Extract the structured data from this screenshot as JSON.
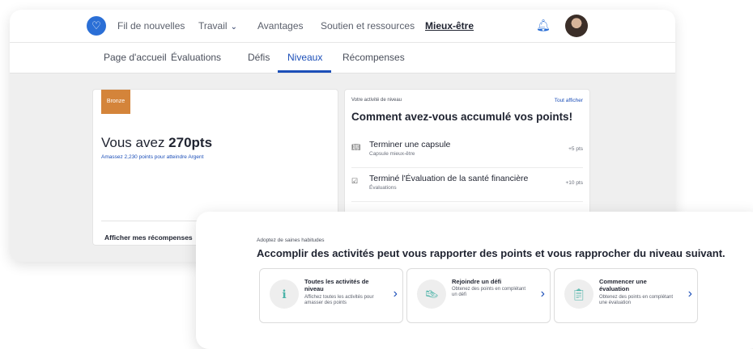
{
  "nav": {
    "items": [
      "Fil de nouvelles",
      "Travail",
      "Avantages",
      "Soutien et ressources",
      "Mieux-être"
    ]
  },
  "tabs": [
    "Page d'accueil",
    "Évaluations",
    "Défis",
    "Niveaux",
    "Récompenses"
  ],
  "level_card": {
    "badge": "Bronze",
    "points_prefix": "Vous avez ",
    "points_value": "270pts",
    "subtitle": "Amassez 2,230 points pour atteindre Argent",
    "rewards_link": "Afficher mes récompenses"
  },
  "activity_card": {
    "eyebrow": "Votre activité de niveau",
    "view_all": "Tout afficher",
    "title": "Comment avez-vous accumulé vos points!",
    "items": [
      {
        "title": "Terminer une capsule",
        "subtitle": "Capsule mieux-être",
        "points": "+5 pts",
        "icon": "book-icon"
      },
      {
        "title": "Terminé l'Évaluation de la santé financière",
        "subtitle": "Évaluations",
        "points": "+10 pts",
        "icon": "checklist-icon"
      }
    ]
  },
  "habits": {
    "eyebrow": "Adoptez de saines habitudes",
    "title": "Accomplir des activités peut vous rapporter des points et vous rapprocher du niveau suivant.",
    "tiles": [
      {
        "title": "Toutes les activités de niveau",
        "subtitle": "Affichez toutes les activités pour amasser des points",
        "icon": "info-icon"
      },
      {
        "title": "Rejoindre un défi",
        "subtitle": "Obtenez des points en complétant un défi",
        "icon": "sneaker-icon"
      },
      {
        "title": "Commencer une évaluation",
        "subtitle": "Obtenez des points en complétant une évaluation",
        "icon": "clipboard-icon"
      }
    ]
  },
  "colors": {
    "accent": "#1c4fb8",
    "bronze": "#d4843a"
  }
}
